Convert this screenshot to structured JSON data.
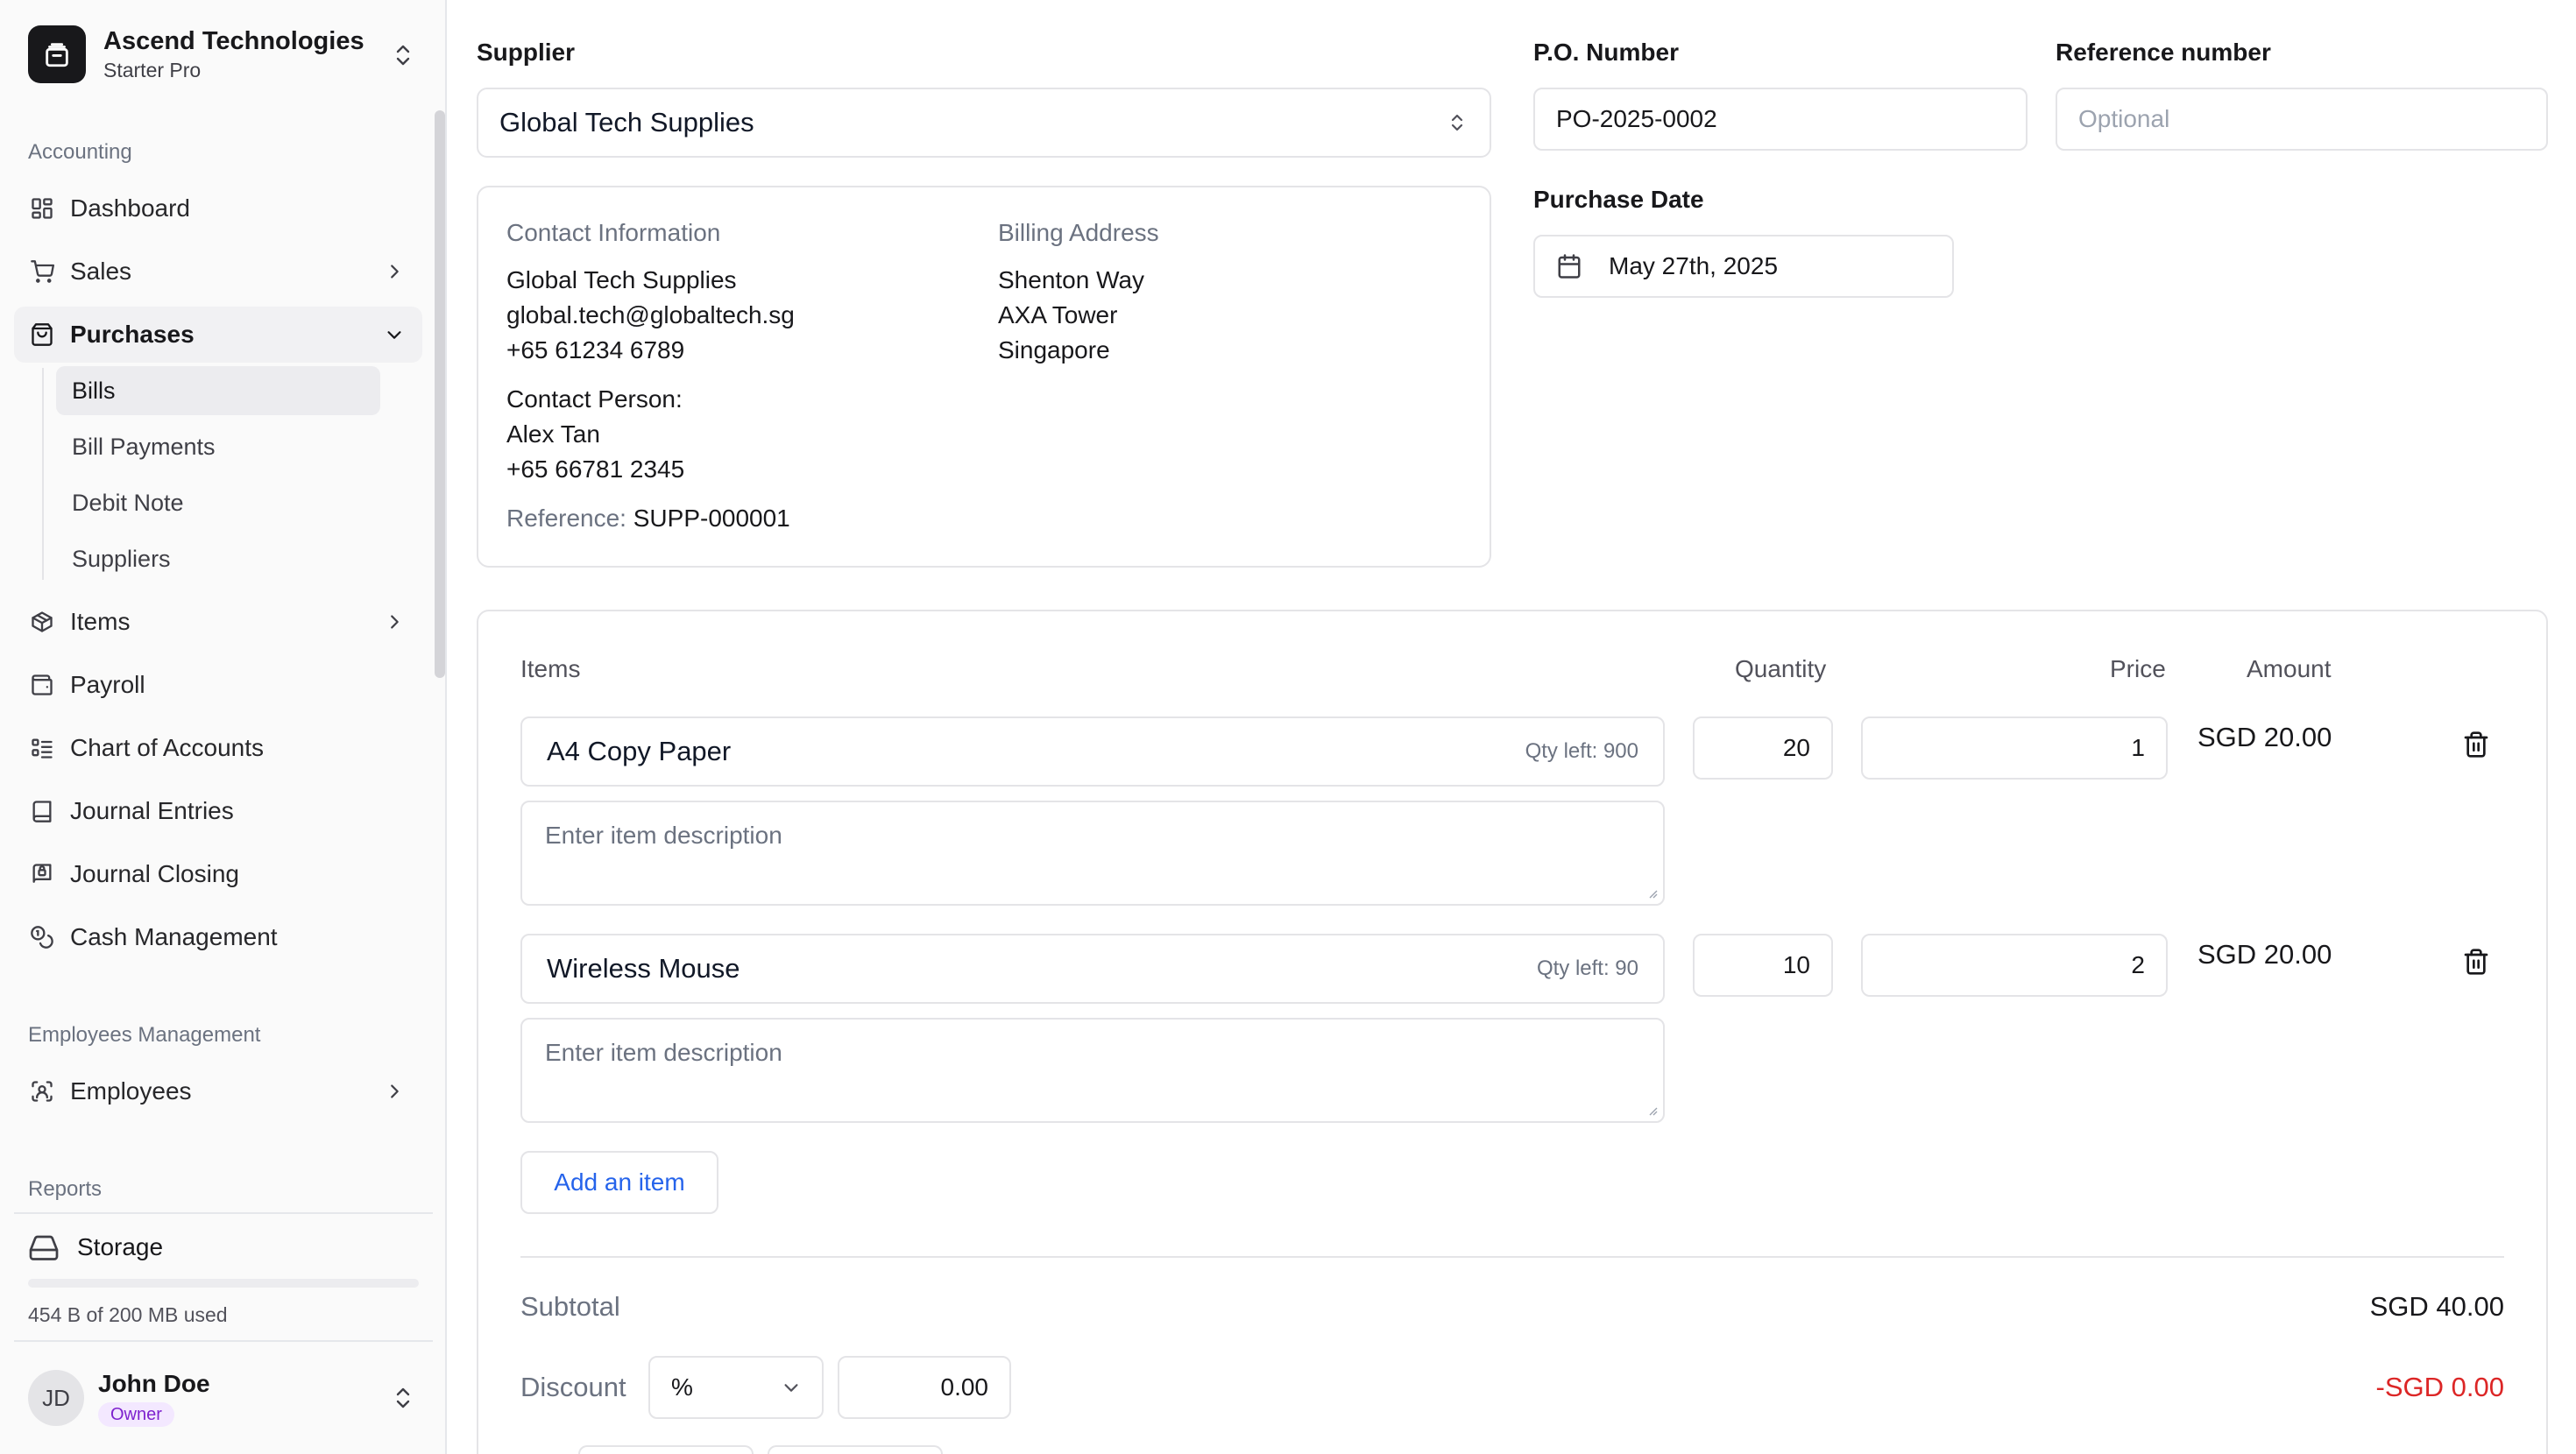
{
  "sidebar": {
    "brand": {
      "name": "Ascend Technologies",
      "plan": "Starter Pro",
      "icon": "building-icon"
    },
    "sections": {
      "accounting": "Accounting",
      "employees": "Employees Management",
      "reports": "Reports"
    },
    "items": {
      "dashboard": "Dashboard",
      "sales": "Sales",
      "purchases": "Purchases",
      "items": "Items",
      "payroll": "Payroll",
      "chart_of_accounts": "Chart of Accounts",
      "journal_entries": "Journal Entries",
      "journal_closing": "Journal Closing",
      "cash_management": "Cash Management",
      "employees": "Employees"
    },
    "purchases_sub": [
      "Bills",
      "Bill Payments",
      "Debit Note",
      "Suppliers"
    ],
    "active_sub": "Bills",
    "storage": {
      "label": "Storage",
      "usage": "454 B of 200 MB used",
      "used_fraction": 2.2e-06
    },
    "user": {
      "initials": "JD",
      "name": "John Doe",
      "role": "Owner"
    }
  },
  "form": {
    "supplier_label": "Supplier",
    "supplier_value": "Global Tech Supplies",
    "po_label": "P.O. Number",
    "po_value": "PO-2025-0002",
    "ref_label": "Reference number",
    "ref_placeholder": "Optional",
    "date_label": "Purchase Date",
    "date_value": "May 27th, 2025"
  },
  "supplier_card": {
    "contact_title": "Contact Information",
    "company": "Global Tech Supplies",
    "email": "global.tech@globaltech.sg",
    "phone": "+65 61234 6789",
    "contact_person_label": "Contact Person:",
    "contact_person": "Alex Tan",
    "contact_phone": "+65 66781 2345",
    "reference_label": "Reference:",
    "reference_value": "SUPP-000001",
    "billing_title": "Billing Address",
    "address": [
      "Shenton Way",
      "AXA Tower",
      "Singapore"
    ]
  },
  "items_table": {
    "headers": {
      "items": "Items",
      "quantity": "Quantity",
      "price": "Price",
      "amount": "Amount"
    },
    "desc_placeholder": "Enter item description",
    "rows": [
      {
        "name": "A4 Copy Paper",
        "qty_left": "Qty left: 900",
        "quantity": "20",
        "price": "1",
        "amount": "SGD 20.00"
      },
      {
        "name": "Wireless Mouse",
        "qty_left": "Qty left: 90",
        "quantity": "10",
        "price": "2",
        "amount": "SGD 20.00"
      }
    ],
    "add_label": "Add an item"
  },
  "totals": {
    "subtotal_label": "Subtotal",
    "subtotal_value": "SGD 40.00",
    "discount_label": "Discount",
    "discount_type": "%",
    "discount_value": "0.00",
    "discount_amount": "-SGD 0.00",
    "discount_color": "#dc2626"
  }
}
